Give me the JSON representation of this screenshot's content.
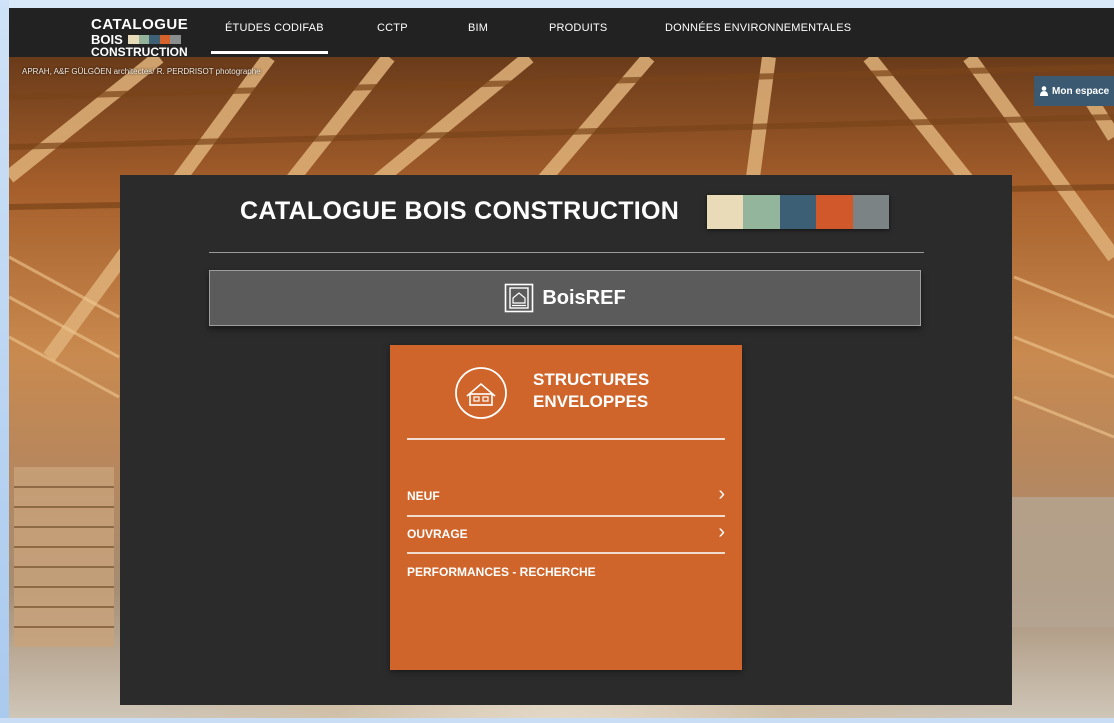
{
  "logo": {
    "line1": "CATALOGUE",
    "line2": "BOIS",
    "line3": "CONSTRUCTION",
    "stripe_colors": [
      "#e8dbb9",
      "#94b49a",
      "#3f6178",
      "#d5612b",
      "#8a8e8e"
    ]
  },
  "nav": {
    "items": [
      {
        "label": "ÉTUDES CODIFAB",
        "active": true
      },
      {
        "label": "CCTP"
      },
      {
        "label": "BIM"
      },
      {
        "label": "PRODUITS"
      },
      {
        "label": "DONNÉES ENVIRONNEMENTALES"
      }
    ]
  },
  "hero": {
    "credit": "APRAH, A&F GÜLGÖEN architectes/ R. PERDRISOT photographe"
  },
  "account": {
    "label": "Mon espace",
    "icon": "user-icon"
  },
  "panel": {
    "title": "CATALOGUE BOIS CONSTRUCTION",
    "swatch_colors": [
      "#e9dbb7",
      "#93b59c",
      "#3c5f76",
      "#d1582a",
      "#7c8384"
    ],
    "boisref": {
      "label": "BoisREF",
      "icon": "document-icon"
    }
  },
  "card": {
    "title_line1": "STRUCTURES",
    "title_line2": "ENVELOPPES",
    "icon": "house-icon",
    "items": [
      {
        "label": "NEUF",
        "chevron": "›"
      },
      {
        "label": "OUVRAGE",
        "chevron": "›"
      },
      {
        "label": "PERFORMANCES - RECHERCHE"
      }
    ]
  },
  "colors": {
    "card_orange": "#d0652b",
    "panel_dark": "#2b2b2b",
    "topbar": "#222222",
    "account_blue": "#3b5a72"
  }
}
